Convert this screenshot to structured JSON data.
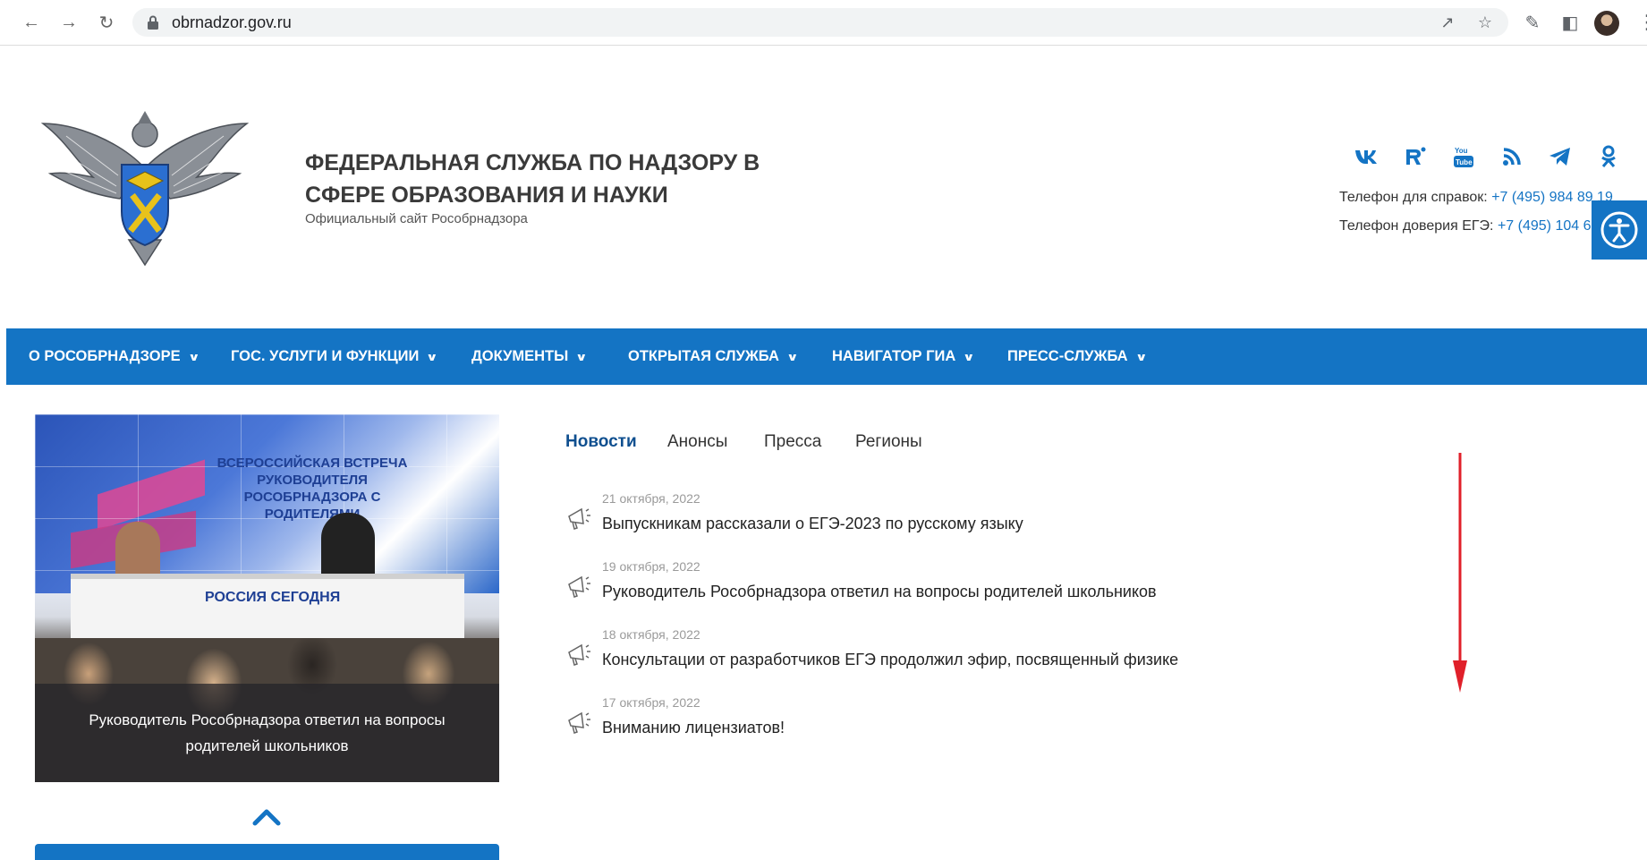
{
  "browser": {
    "url": "obrnadzor.gov.ru"
  },
  "header": {
    "title": "ФЕДЕРАЛЬНАЯ СЛУЖБА ПО НАДЗОРУ В СФЕРЕ ОБРАЗОВАНИЯ И НАУКИ",
    "subtitle": "Официальный сайт Рособрнадзора",
    "social": [
      "vk-icon",
      "rutube-icon",
      "youtube-icon",
      "rss-icon",
      "telegram-icon",
      "odnoklassniki-icon"
    ],
    "phone1_label": "Телефон для справок:",
    "phone1_number": "+7 (495) 984 89 19",
    "phone2_label": "Телефон доверия ЕГЭ:",
    "phone2_number": "+7 (495) 104 6"
  },
  "nav": {
    "items": [
      {
        "label": "О РОСОБРНАДЗОРЕ"
      },
      {
        "label": "ГОС. УСЛУГИ И ФУНКЦИИ"
      },
      {
        "label": "ДОКУМЕНТЫ"
      },
      {
        "label": "ОТКРЫТАЯ СЛУЖБА"
      },
      {
        "label": "НАВИГАТОР ГИА"
      },
      {
        "label": "ПРЕСС-СЛУЖБА"
      }
    ]
  },
  "feature": {
    "banner": "ВСЕРОССИЙСКАЯ ВСТРЕЧА РУКОВОДИТЕЛЯ РОСОБРНАДЗОРА С РОДИТЕЛЯМИ",
    "brand": "РОССИЯ СЕГОДНЯ",
    "caption": "Руководитель Рособрнадзора ответил на вопросы родителей школьников"
  },
  "news": {
    "tabs": [
      {
        "label": "Новости",
        "active": true
      },
      {
        "label": "Анонсы"
      },
      {
        "label": "Пресса"
      },
      {
        "label": "Регионы"
      }
    ],
    "items": [
      {
        "date": "21 октября, 2022",
        "title": "Выпускникам рассказали о ЕГЭ-2023 по русскому языку"
      },
      {
        "date": "19 октября, 2022",
        "title": "Руководитель Рособрнадзора ответил на вопросы родителей школьников"
      },
      {
        "date": "18 октября, 2022",
        "title": "Консультации от разработчиков ЕГЭ продолжил эфир, посвященный физике"
      },
      {
        "date": "17 октября, 2022",
        "title": "Вниманию лицензиатов!"
      }
    ]
  },
  "colors": {
    "brand_blue": "#1474c4",
    "arrow_red": "#e0202a"
  }
}
